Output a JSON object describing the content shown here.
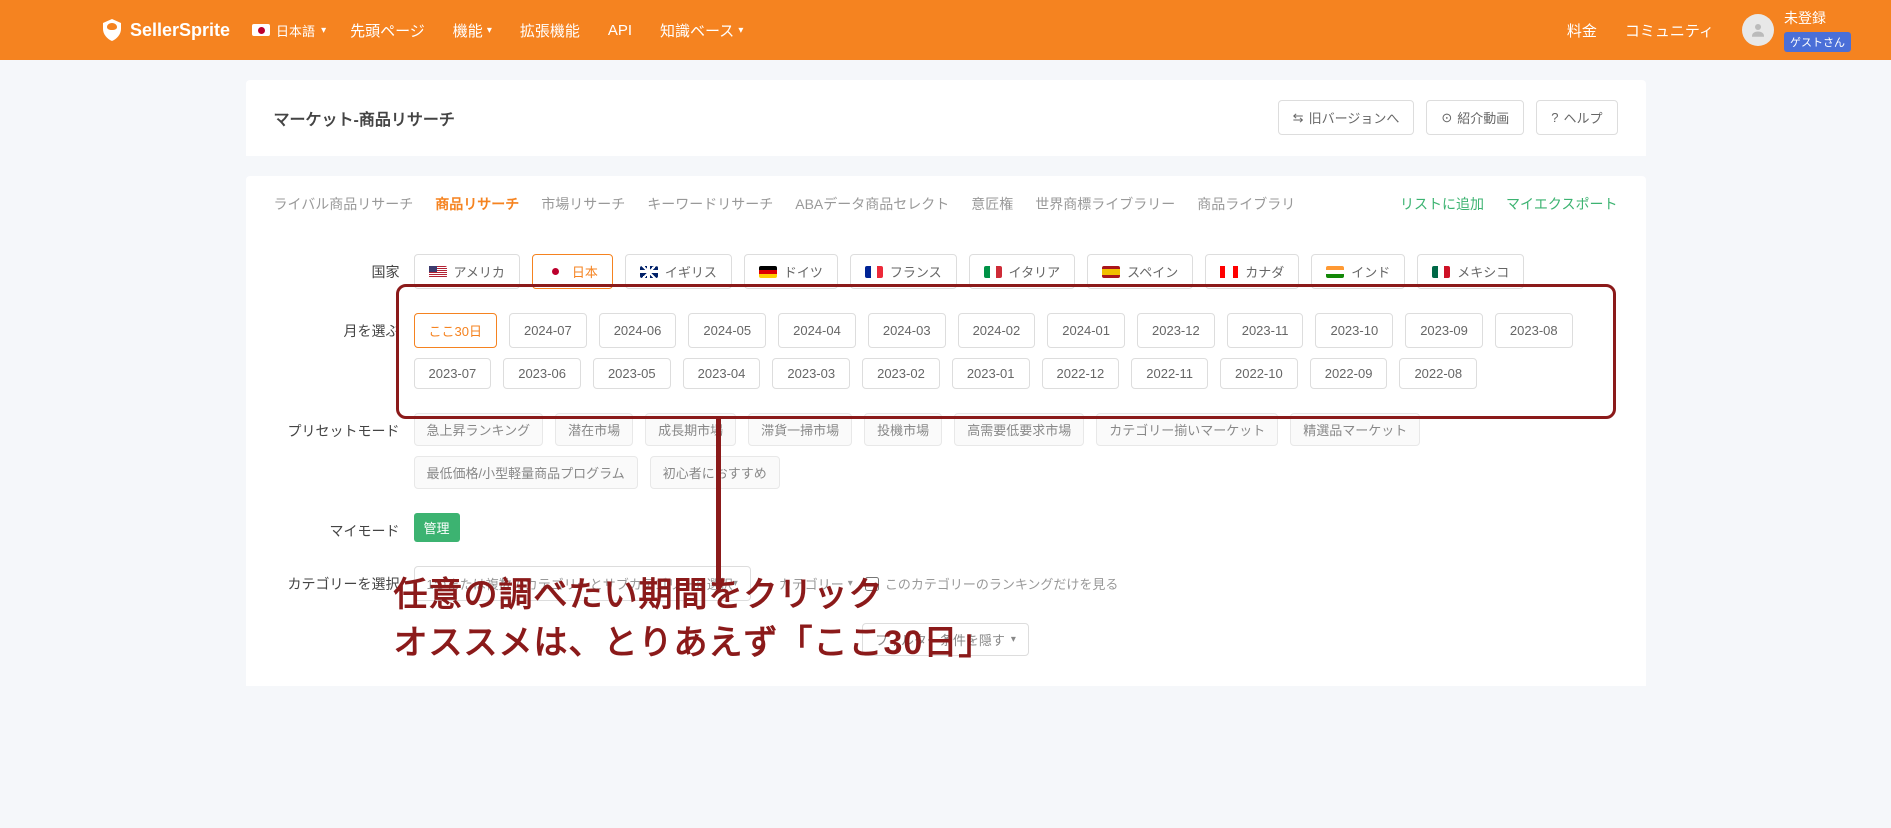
{
  "header": {
    "brand": "SellerSprite",
    "lang_label": "日本語",
    "nav": {
      "top": "先頭ページ",
      "features": "機能",
      "ext": "拡張機能",
      "api": "API",
      "kb": "知識ベース"
    },
    "right": {
      "pricing": "料金",
      "community": "コミュニティ",
      "unreg": "未登録",
      "guest": "ゲストさん"
    }
  },
  "page": {
    "title": "マーケット-商品リサーチ",
    "old_version": "旧バージョンへ",
    "intro_video": "紹介動画",
    "help": "ヘルプ"
  },
  "tabs": {
    "t0": "ライバル商品リサーチ",
    "t1": "商品リサーチ",
    "t2": "市場リサーチ",
    "t3": "キーワードリサーチ",
    "t4": "ABAデータ商品セレクト",
    "t5": "意匠権",
    "t6": "世界商標ライブラリー",
    "t7": "商品ライブラリ",
    "add_list": "リストに追加",
    "my_export": "マイエクスポート"
  },
  "labels": {
    "country": "国家",
    "month": "月を選ぶ",
    "preset": "プリセットモード",
    "mymode": "マイモード",
    "category": "カテゴリーを選択"
  },
  "countries": {
    "us": "アメリカ",
    "jp": "日本",
    "uk": "イギリス",
    "de": "ドイツ",
    "fr": "フランス",
    "it": "イタリア",
    "es": "スペイン",
    "ca": "カナダ",
    "in": "インド",
    "mx": "メキシコ"
  },
  "months": {
    "m0": "ここ30日",
    "m1": "2024-07",
    "m2": "2024-06",
    "m3": "2024-05",
    "m4": "2024-04",
    "m5": "2024-03",
    "m6": "2024-02",
    "m7": "2024-01",
    "m8": "2023-12",
    "m9": "2023-11",
    "m10": "2023-10",
    "m11": "2023-09",
    "m12": "2023-08",
    "m13": "2023-07",
    "m14": "2023-06",
    "m15": "2023-05",
    "m16": "2023-04",
    "m17": "2023-03",
    "m18": "2023-02",
    "m19": "2023-01",
    "m20": "2022-12",
    "m21": "2022-11",
    "m22": "2022-10",
    "m23": "2022-09",
    "m24": "2022-08"
  },
  "presets": {
    "p0": "急上昇ランキング",
    "p1": "潜在市場",
    "p2": "成長期市場",
    "p3": "滞貨一掃市場",
    "p4": "投機市場",
    "p5": "高需要低要求市場",
    "p6": "カテゴリー揃いマーケット",
    "p7": "精選品マーケット",
    "p8": "最低価格/小型軽量商品プログラム",
    "p9": "初心者におすすめ"
  },
  "mymode": {
    "manage": "管理"
  },
  "category": {
    "placeholder": "1つまたは複数のカテゴリーとサブカテゴリーを選択",
    "dd": "カテゴリー",
    "check_label": "このカテゴリーのランキングだけを見る"
  },
  "filter_dd": "フィルター条件を隠す",
  "annotation": {
    "line1": "任意の調べたい期間をクリック",
    "line2": "オススメは、とりあえず「ここ30日」"
  }
}
